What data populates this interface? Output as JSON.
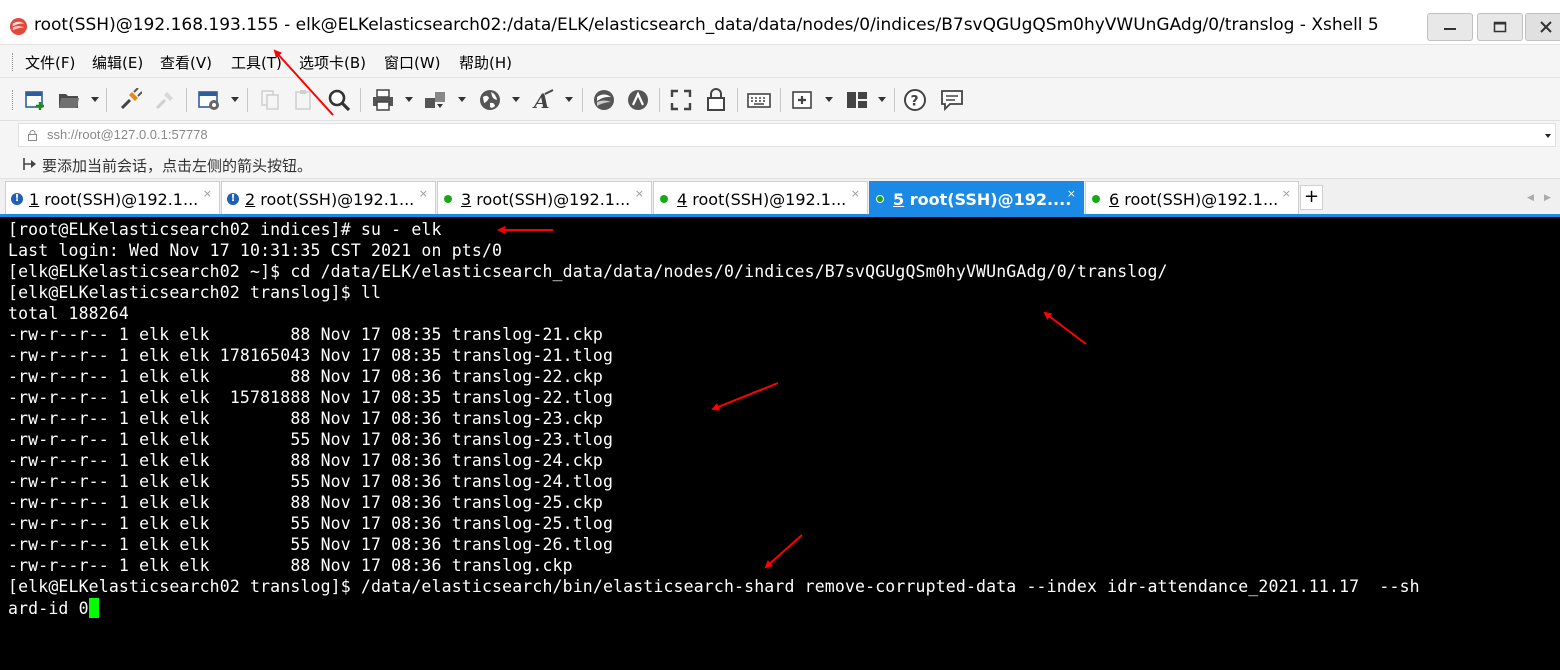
{
  "window": {
    "title": "root(SSH)@192.168.193.155 - elk@ELKelasticsearch02:/data/ELK/elasticsearch_data/data/nodes/0/indices/B7svQGUgQSm0hyVWUnGAdg/0/translog - Xshell 5",
    "minimize": "—",
    "maximize": "□"
  },
  "menu": {
    "items": [
      "文件(F)",
      "编辑(E)",
      "查看(V)",
      "工具(T)",
      "选项卡(B)",
      "窗口(W)",
      "帮助(H)"
    ]
  },
  "address": {
    "value": "ssh://root@127.0.0.1:57778"
  },
  "hint": {
    "text": "要添加当前会话，点击左侧的箭头按钮。"
  },
  "tabs": [
    {
      "num": "1",
      "label": " root(SSH)@192.1...",
      "close": "×",
      "status": "warning"
    },
    {
      "num": "2",
      "label": " root(SSH)@192.1...",
      "close": "×",
      "status": "warning"
    },
    {
      "num": "3",
      "label": " root(SSH)@192.1...",
      "close": "×",
      "status": "connected"
    },
    {
      "num": "4",
      "label": " root(SSH)@192.1...",
      "close": "×",
      "status": "connected"
    },
    {
      "num": "5",
      "label": " root(SSH)@192....",
      "close": "×",
      "status": "connected",
      "active": true
    },
    {
      "num": "6",
      "label": " root(SSH)@192.1...",
      "close": "×",
      "status": "connected"
    }
  ],
  "tab_add": "+",
  "tab_nav": {
    "left": "◀",
    "right": "▶"
  },
  "terminal": {
    "lines": [
      "[root@ELKelasticsearch02 indices]# su - elk",
      "Last login: Wed Nov 17 10:31:35 CST 2021 on pts/0",
      "[elk@ELKelasticsearch02 ~]$ cd /data/ELK/elasticsearch_data/data/nodes/0/indices/B7svQGUgQSm0hyVWUnGAdg/0/translog/",
      "[elk@ELKelasticsearch02 translog]$ ll",
      "total 188264",
      "-rw-r--r-- 1 elk elk        88 Nov 17 08:35 translog-21.ckp",
      "-rw-r--r-- 1 elk elk 178165043 Nov 17 08:35 translog-21.tlog",
      "-rw-r--r-- 1 elk elk        88 Nov 17 08:36 translog-22.ckp",
      "-rw-r--r-- 1 elk elk  15781888 Nov 17 08:35 translog-22.tlog",
      "-rw-r--r-- 1 elk elk        88 Nov 17 08:36 translog-23.ckp",
      "-rw-r--r-- 1 elk elk        55 Nov 17 08:36 translog-23.tlog",
      "-rw-r--r-- 1 elk elk        88 Nov 17 08:36 translog-24.ckp",
      "-rw-r--r-- 1 elk elk        55 Nov 17 08:36 translog-24.tlog",
      "-rw-r--r-- 1 elk elk        88 Nov 17 08:36 translog-25.ckp",
      "-rw-r--r-- 1 elk elk        55 Nov 17 08:36 translog-25.tlog",
      "-rw-r--r-- 1 elk elk        55 Nov 17 08:36 translog-26.tlog",
      "-rw-r--r-- 1 elk elk        88 Nov 17 08:36 translog.ckp",
      "[elk@ELKelasticsearch02 translog]$ /data/elasticsearch/bin/elasticsearch-shard remove-corrupted-data --index idr-attendance_2021.11.17  --sh",
      "ard-id 0"
    ]
  },
  "colors": {
    "terminal_bg": "#000000",
    "terminal_fg": "#ffffff",
    "cursor": "#00ff00",
    "active_tab": "#1a8ae6",
    "connected_dot": "#18a818",
    "annotation_arrow": "#ff0000"
  }
}
